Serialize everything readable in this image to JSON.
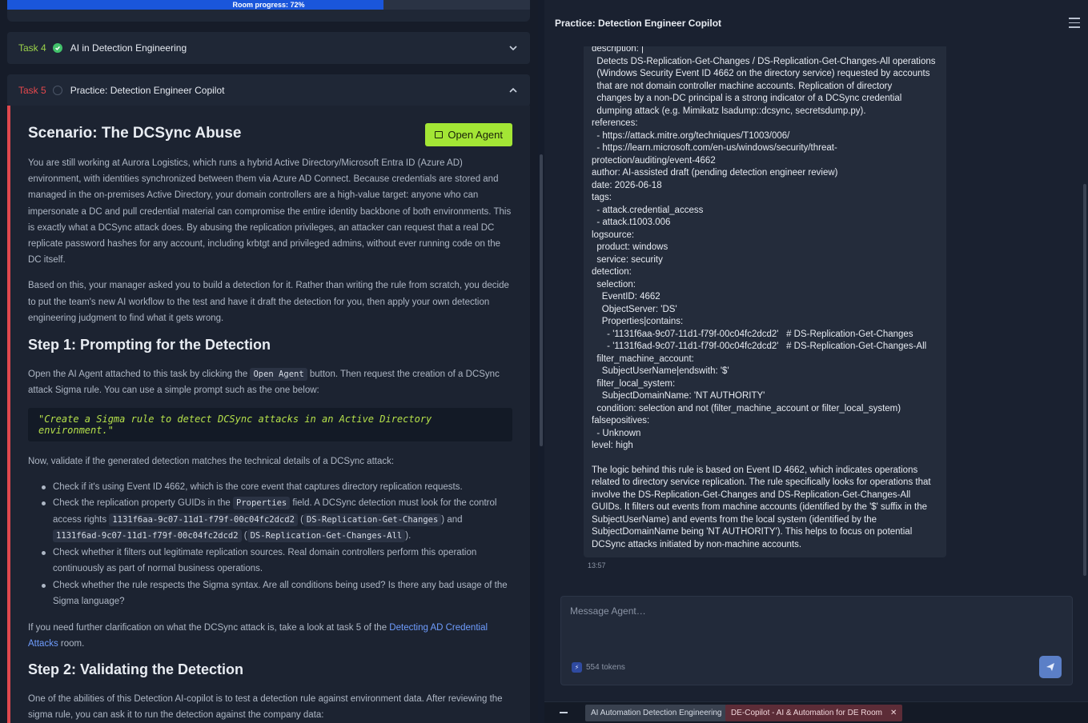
{
  "progress": {
    "label": "Room progress: 72%",
    "value": 0.72
  },
  "tasks": [
    {
      "num": "Task 4",
      "title": "AI in Detection Engineering",
      "status": "complete"
    },
    {
      "num": "Task 5",
      "title": "Practice: Detection Engineer Copilot",
      "status": "open"
    }
  ],
  "content": {
    "scenario_title": "Scenario: The DCSync Abuse",
    "open_agent_label": "Open Agent",
    "p1": "You are still working at Aurora Logistics, which runs a hybrid Active Directory/Microsoft Entra ID (Azure AD) environment, with identities synchronized between them via Azure AD Connect. Because credentials are stored and managed in the on-premises Active Directory, your domain controllers are a high-value target: anyone who can impersonate a DC and pull credential material can compromise the entire identity backbone of both environments. This is exactly what a DCSync attack does. By abusing the replication privileges, an attacker can request that a real DC replicate password hashes for any account, including krbtgt and privileged admins, without ever running code on the DC itself.",
    "p2": "Based on this, your manager asked you to build a detection for it. Rather than writing the rule from scratch, you decide to put the team's new AI workflow to the test and have it draft the detection for you, then apply your own detection engineering judgment to find what it gets wrong.",
    "step1_title": "Step 1: Prompting for the Detection",
    "p3_a": "Open the AI Agent attached to this task by clicking the ",
    "p3_code": "Open Agent",
    "p3_b": " button. Then request the creation of a DCSync attack Sigma rule. You can use a simple prompt such as the one below:",
    "prompt_example": "\"Create a Sigma rule to detect DCSync attacks in an Active Directory environment.\"",
    "p4": "Now, validate if the generated detection matches the technical details of a DCSync attack:",
    "bullet1": "Check if it's using Event ID 4662, which is the core event that captures directory replication requests.",
    "bullet2_a": "Check the replication property GUIDs in the ",
    "bullet2_code1": "Properties",
    "bullet2_b": " field. A DCSync detection must look for the control access rights ",
    "bullet2_code2": "1131f6aa-9c07-11d1-f79f-00c04fc2dcd2",
    "bullet2_c": " (",
    "bullet2_code3": "DS-Replication-Get-Changes",
    "bullet2_d": ") and ",
    "bullet2_code4": "1131f6ad-9c07-11d1-f79f-00c04fc2dcd2",
    "bullet2_e": " (",
    "bullet2_code5": "DS-Replication-Get-Changes-All",
    "bullet2_f": ").",
    "bullet3": "Check whether it filters out legitimate replication sources. Real domain controllers perform this operation continuously as part of normal business operations.",
    "bullet4": "Check whether the rule respects the Sigma syntax. Are all conditions being used? Is there any bad usage of the Sigma language?",
    "p5_a": "If you need further clarification on what the DCSync attack is, take a look at task 5 of the ",
    "p5_link": "Detecting AD Credential Attacks",
    "p5_b": " room.",
    "step2_title": "Step 2: Validating the Detection",
    "p6": "One of the abilities of this Detection AI-copilot is to test a detection rule against environment data. After reviewing the sigma rule, you can ask it to run the detection against the company data:"
  },
  "agent": {
    "title": "Practice: Detection Engineer Copilot",
    "rule_text": "description: |\n  Detects DS-Replication-Get-Changes / DS-Replication-Get-Changes-All operations\n  (Windows Security Event ID 4662 on the directory service) requested by accounts\n  that are not domain controller machine accounts. Replication of directory\n  changes by a non-DC principal is a strong indicator of a DCSync credential\n  dumping attack (e.g. Mimikatz lsadump::dcsync, secretsdump.py).\nreferences:\n  - https://attack.mitre.org/techniques/T1003/006/\n  - https://learn.microsoft.com/en-us/windows/security/threat-\nprotection/auditing/event-4662\nauthor: AI-assisted draft (pending detection engineer review)\ndate: 2026-06-18\ntags:\n  - attack.credential_access\n  - attack.t1003.006\nlogsource:\n  product: windows\n  service: security\ndetection:\n  selection:\n    EventID: 4662\n    ObjectServer: 'DS'\n    Properties|contains:\n      - '1131f6aa-9c07-11d1-f79f-00c04fc2dcd2'   # DS-Replication-Get-Changes\n      - '1131f6ad-9c07-11d1-f79f-00c04fc2dcd2'   # DS-Replication-Get-Changes-All\n  filter_machine_account:\n    SubjectUserName|endswith: '$'\n  filter_local_system:\n    SubjectDomainName: 'NT AUTHORITY'\n  condition: selection and not (filter_machine_account or filter_local_system)\nfalsepositives:\n  - Unknown\nlevel: high",
    "explanation": "The logic behind this rule is based on Event ID 4662, which indicates operations related to directory service replication. The rule specifically looks for operations that involve the DS-Replication-Get-Changes and DS-Replication-Get-Changes-All GUIDs. It filters out events from machine accounts (identified by the '$' suffix in the SubjectUserName) and events from the local system (identified by the SubjectDomainName being 'NT AUTHORITY'). This helps to focus on potential DCSync attacks initiated by non-machine accounts.",
    "timestamp": "13:57",
    "input_placeholder": "Message Agent…",
    "tokens": "554 tokens"
  },
  "bottom_tabs": [
    {
      "label": "AI Automation Detection Engineering"
    },
    {
      "label": "DE-Copilot - AI & Automation for DE Room",
      "close": "✕"
    }
  ],
  "colors": {
    "accent_green": "#a3e635",
    "accent_red": "#e0484e",
    "link": "#6f9dff",
    "progress": "#1a56db"
  }
}
